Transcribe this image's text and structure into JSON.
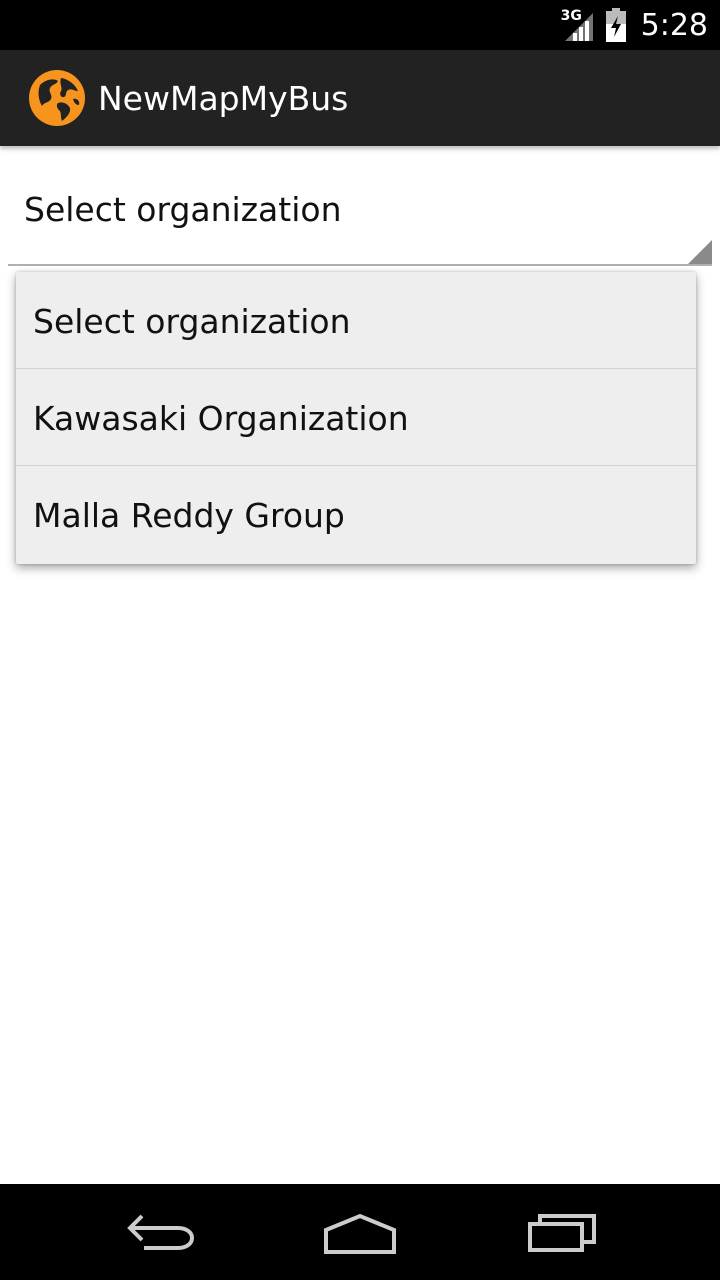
{
  "status_bar": {
    "network_type": "3G",
    "time": "5:28",
    "icons": [
      "signal-icon",
      "battery-icon"
    ]
  },
  "action_bar": {
    "app_icon": "globe-icon",
    "title": "NewMapMyBus",
    "accent_color": "#F7941D"
  },
  "spinner": {
    "selected": "Select organization"
  },
  "dropdown": {
    "items": [
      {
        "label": "Select organization"
      },
      {
        "label": "Kawasaki Organization"
      },
      {
        "label": "Malla Reddy Group"
      }
    ]
  },
  "nav_bar": {
    "buttons": [
      "back-icon",
      "home-icon",
      "recent-apps-icon"
    ]
  }
}
